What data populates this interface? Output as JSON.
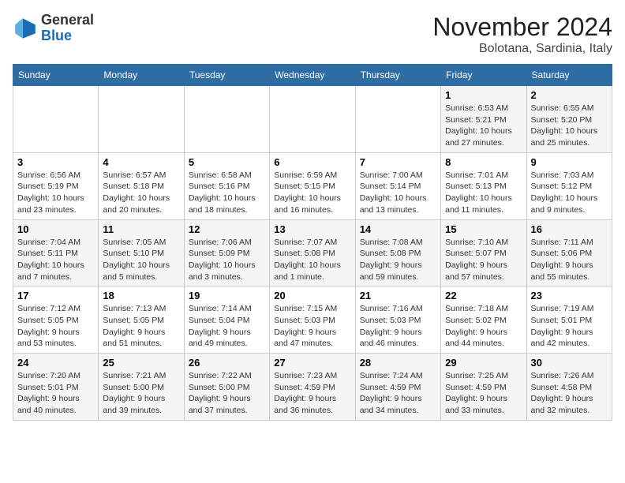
{
  "header": {
    "logo_line1": "General",
    "logo_line2": "Blue",
    "month": "November 2024",
    "location": "Bolotana, Sardinia, Italy"
  },
  "weekdays": [
    "Sunday",
    "Monday",
    "Tuesday",
    "Wednesday",
    "Thursday",
    "Friday",
    "Saturday"
  ],
  "weeks": [
    [
      {
        "day": "",
        "info": ""
      },
      {
        "day": "",
        "info": ""
      },
      {
        "day": "",
        "info": ""
      },
      {
        "day": "",
        "info": ""
      },
      {
        "day": "",
        "info": ""
      },
      {
        "day": "1",
        "info": "Sunrise: 6:53 AM\nSunset: 5:21 PM\nDaylight: 10 hours\nand 27 minutes."
      },
      {
        "day": "2",
        "info": "Sunrise: 6:55 AM\nSunset: 5:20 PM\nDaylight: 10 hours\nand 25 minutes."
      }
    ],
    [
      {
        "day": "3",
        "info": "Sunrise: 6:56 AM\nSunset: 5:19 PM\nDaylight: 10 hours\nand 23 minutes."
      },
      {
        "day": "4",
        "info": "Sunrise: 6:57 AM\nSunset: 5:18 PM\nDaylight: 10 hours\nand 20 minutes."
      },
      {
        "day": "5",
        "info": "Sunrise: 6:58 AM\nSunset: 5:16 PM\nDaylight: 10 hours\nand 18 minutes."
      },
      {
        "day": "6",
        "info": "Sunrise: 6:59 AM\nSunset: 5:15 PM\nDaylight: 10 hours\nand 16 minutes."
      },
      {
        "day": "7",
        "info": "Sunrise: 7:00 AM\nSunset: 5:14 PM\nDaylight: 10 hours\nand 13 minutes."
      },
      {
        "day": "8",
        "info": "Sunrise: 7:01 AM\nSunset: 5:13 PM\nDaylight: 10 hours\nand 11 minutes."
      },
      {
        "day": "9",
        "info": "Sunrise: 7:03 AM\nSunset: 5:12 PM\nDaylight: 10 hours\nand 9 minutes."
      }
    ],
    [
      {
        "day": "10",
        "info": "Sunrise: 7:04 AM\nSunset: 5:11 PM\nDaylight: 10 hours\nand 7 minutes."
      },
      {
        "day": "11",
        "info": "Sunrise: 7:05 AM\nSunset: 5:10 PM\nDaylight: 10 hours\nand 5 minutes."
      },
      {
        "day": "12",
        "info": "Sunrise: 7:06 AM\nSunset: 5:09 PM\nDaylight: 10 hours\nand 3 minutes."
      },
      {
        "day": "13",
        "info": "Sunrise: 7:07 AM\nSunset: 5:08 PM\nDaylight: 10 hours\nand 1 minute."
      },
      {
        "day": "14",
        "info": "Sunrise: 7:08 AM\nSunset: 5:08 PM\nDaylight: 9 hours\nand 59 minutes."
      },
      {
        "day": "15",
        "info": "Sunrise: 7:10 AM\nSunset: 5:07 PM\nDaylight: 9 hours\nand 57 minutes."
      },
      {
        "day": "16",
        "info": "Sunrise: 7:11 AM\nSunset: 5:06 PM\nDaylight: 9 hours\nand 55 minutes."
      }
    ],
    [
      {
        "day": "17",
        "info": "Sunrise: 7:12 AM\nSunset: 5:05 PM\nDaylight: 9 hours\nand 53 minutes."
      },
      {
        "day": "18",
        "info": "Sunrise: 7:13 AM\nSunset: 5:05 PM\nDaylight: 9 hours\nand 51 minutes."
      },
      {
        "day": "19",
        "info": "Sunrise: 7:14 AM\nSunset: 5:04 PM\nDaylight: 9 hours\nand 49 minutes."
      },
      {
        "day": "20",
        "info": "Sunrise: 7:15 AM\nSunset: 5:03 PM\nDaylight: 9 hours\nand 47 minutes."
      },
      {
        "day": "21",
        "info": "Sunrise: 7:16 AM\nSunset: 5:03 PM\nDaylight: 9 hours\nand 46 minutes."
      },
      {
        "day": "22",
        "info": "Sunrise: 7:18 AM\nSunset: 5:02 PM\nDaylight: 9 hours\nand 44 minutes."
      },
      {
        "day": "23",
        "info": "Sunrise: 7:19 AM\nSunset: 5:01 PM\nDaylight: 9 hours\nand 42 minutes."
      }
    ],
    [
      {
        "day": "24",
        "info": "Sunrise: 7:20 AM\nSunset: 5:01 PM\nDaylight: 9 hours\nand 40 minutes."
      },
      {
        "day": "25",
        "info": "Sunrise: 7:21 AM\nSunset: 5:00 PM\nDaylight: 9 hours\nand 39 minutes."
      },
      {
        "day": "26",
        "info": "Sunrise: 7:22 AM\nSunset: 5:00 PM\nDaylight: 9 hours\nand 37 minutes."
      },
      {
        "day": "27",
        "info": "Sunrise: 7:23 AM\nSunset: 4:59 PM\nDaylight: 9 hours\nand 36 minutes."
      },
      {
        "day": "28",
        "info": "Sunrise: 7:24 AM\nSunset: 4:59 PM\nDaylight: 9 hours\nand 34 minutes."
      },
      {
        "day": "29",
        "info": "Sunrise: 7:25 AM\nSunset: 4:59 PM\nDaylight: 9 hours\nand 33 minutes."
      },
      {
        "day": "30",
        "info": "Sunrise: 7:26 AM\nSunset: 4:58 PM\nDaylight: 9 hours\nand 32 minutes."
      }
    ]
  ]
}
